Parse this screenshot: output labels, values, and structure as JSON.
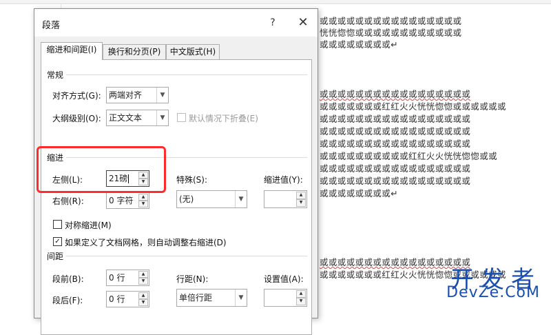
{
  "dialog": {
    "title": "段落",
    "help_label": "?",
    "close_label": "✕",
    "tabs": [
      {
        "label": "缩进和间距(I)",
        "active": true
      },
      {
        "label": "换行和分页(P)",
        "active": false
      },
      {
        "label": "中文版式(H)",
        "active": false
      }
    ],
    "general": {
      "label": "常规",
      "alignment": {
        "label": "对齐方式(G):",
        "value": "两端对齐"
      },
      "outline": {
        "label": "大纲级别(O):",
        "value": "正文文本"
      },
      "collapse_checkbox": {
        "label": "默认情况下折叠(E)",
        "checked": false,
        "enabled": false
      }
    },
    "indent": {
      "label": "缩进",
      "left": {
        "label": "左侧(L):",
        "value": "21磅"
      },
      "right": {
        "label": "右侧(R):",
        "value": "0 字符"
      },
      "special": {
        "label": "特殊(S):",
        "value": "(无)"
      },
      "indent_value": {
        "label": "缩进值(Y):",
        "value": ""
      },
      "mirror": {
        "label": "对称缩进(M)",
        "checked": false
      },
      "auto_adjust": {
        "label": "如果定义了文档网格，则自动调整右缩进(D)",
        "checked": true
      }
    },
    "spacing": {
      "label": "间距",
      "before": {
        "label": "段前(B):",
        "value": "0 行"
      },
      "after": {
        "label": "段后(F):",
        "value": "0 行"
      },
      "line_spacing": {
        "label": "行距(N):",
        "value": "单倍行距"
      },
      "set_value": {
        "label": "设置值(A):",
        "value": ""
      }
    }
  },
  "document": {
    "lines": [
      "或或或或或或或或或或或或或或或或",
      "恍恍惚惚或或或或或或或或或或或或",
      "或或或或或或或或↵",
      "或或或或或或或或或或或或或或或或或",
      "或或或或或或或红红火火恍恍惚惚或或或或或或",
      "或或或或或或或或或或或或或或或或或",
      "或或或或或或或或或或或或或或或或或",
      "或或或或或或或或或或或或或或或或或",
      "或或或或或或或或或或红红火火恍恍惚惚或或",
      "或或或或或或或或或或或或或或或或或",
      "或或或或或或或或或或或或或或或或或",
      "或或或或或或或或↵",
      "或或或或或或或或或或或或或或或或或",
      "或或或或或或或红红火火恍恍惚惚或或或或或或"
    ]
  },
  "watermark": {
    "cn": "开发者",
    "en": "DevZe.CoM"
  },
  "colors": {
    "highlight_box": "#ff2b2b",
    "watermark": "#1a4fb0"
  }
}
